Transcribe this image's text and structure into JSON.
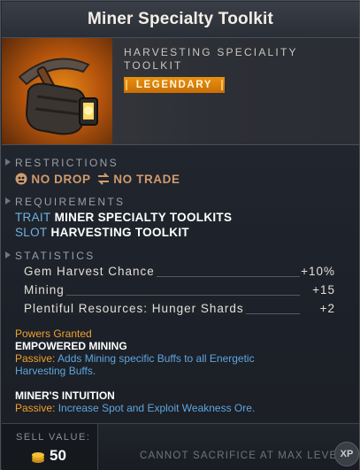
{
  "item": {
    "title": "Miner Specialty Toolkit",
    "subtype_line1": "HARVESTING SPECIALITY",
    "subtype_line2": "TOOLKIT",
    "rarity": "LEGENDARY",
    "icon": "mining-toolkit-icon"
  },
  "restrictions": {
    "header": "RESTRICTIONS",
    "no_drop": "NO DROP",
    "no_trade": "NO TRADE"
  },
  "requirements": {
    "header": "REQUIREMENTS",
    "trait_key": "TRAIT",
    "trait_value": "MINER SPECIALTY TOOLKITS",
    "slot_key": "SLOT",
    "slot_value": "HARVESTING TOOLKIT"
  },
  "statistics": {
    "header": "STATISTICS",
    "rows": [
      {
        "name": "Gem Harvest Chance",
        "value": "+10%"
      },
      {
        "name": "Mining",
        "value": "+15"
      },
      {
        "name": "Plentiful Resources: Hunger Shards",
        "value": "+2"
      }
    ]
  },
  "powers": {
    "header": "Powers Granted",
    "power1_name": "EMPOWERED MINING",
    "power1_prefix": "Passive:",
    "power1_desc_l1": "Adds Mining specific Buffs to all Energetic",
    "power1_desc_l2": "Harvesting Buffs.",
    "power2_name": "MINER'S INTUITION",
    "power2_prefix": "Passive:",
    "power2_desc": "Increase Spot and Exploit Weakness Ore."
  },
  "footer": {
    "sell_label": "SELL VALUE:",
    "sell_value": "50",
    "sacrifice_note": "CANNOT SACRIFICE AT MAX LEVEL",
    "xp_badge": "XP"
  },
  "colors": {
    "rarity": "#e08a0e",
    "highlight_blue": "#5ea6dd",
    "highlight_orange": "#f0a12a"
  }
}
